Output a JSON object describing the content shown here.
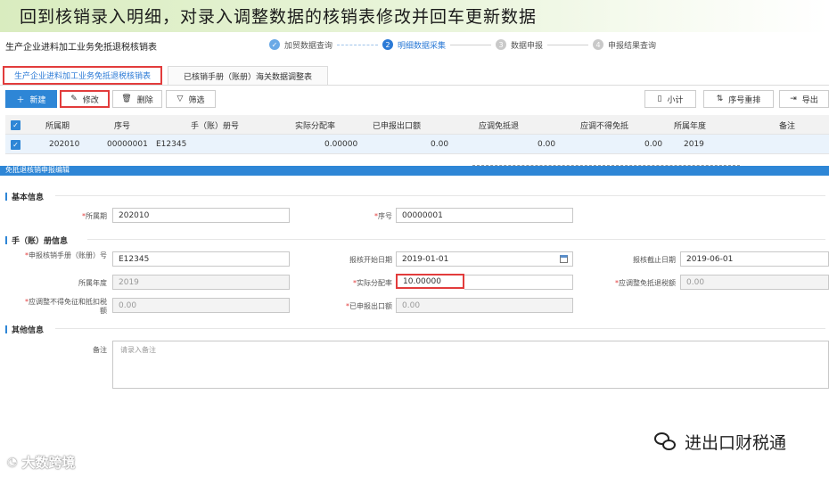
{
  "banner": {
    "title": "回到核销录入明细，对录入调整数据的核销表修改并回车更新数据"
  },
  "page": {
    "title": "生产企业进料加工业务免抵退税核销表"
  },
  "steps": [
    {
      "num": "✓",
      "label": "加贸数据查询"
    },
    {
      "num": "2",
      "label": "明细数据采集"
    },
    {
      "num": "3",
      "label": "数据申报"
    },
    {
      "num": "4",
      "label": "申报结果查询"
    }
  ],
  "tabs": [
    {
      "label": "生产企业进料加工业务免抵退税核销表"
    },
    {
      "label": "已核销手册（账册）海关数据调整表"
    }
  ],
  "toolbar": {
    "new_label": "新建",
    "edit_label": "修改",
    "delete_label": "删除",
    "filter_label": "筛选",
    "subtotal_label": "小计",
    "reorder_label": "序号重排",
    "export_label": "导出"
  },
  "grid": {
    "columns": [
      "所属期",
      "序号",
      "手（账）册号",
      "实际分配率",
      "已申报出口额",
      "应调免抵退",
      "应调不得免抵",
      "所属年度",
      "备注"
    ],
    "rows": [
      [
        "202010",
        "00000001",
        "E12345",
        "0.00000",
        "0.00",
        "0.00",
        "0.00",
        "2019",
        ""
      ]
    ]
  },
  "form": {
    "header": "免抵退核销申报编辑",
    "sections": {
      "basic": "基本信息",
      "manual": "手（账）册信息",
      "other": "其他信息"
    },
    "fields": {
      "period": {
        "label": "所属期",
        "value": "202010"
      },
      "seq": {
        "label": "序号",
        "value": "00000001"
      },
      "manual_no": {
        "label": "申报核销手册（账册）号",
        "value": "E12345"
      },
      "start_date": {
        "label": "报核开始日期",
        "value": "2019-01-01"
      },
      "end_date": {
        "label": "报核截止日期",
        "value": "2019-06-01"
      },
      "year": {
        "label": "所属年度",
        "value": "2019"
      },
      "rate": {
        "label": "实际分配率",
        "value": "10.00000"
      },
      "adj_refund": {
        "label": "应调整免抵退税额",
        "value": "0.00"
      },
      "adj_nondeduct_a": {
        "label": "应调整不得免征和抵扣税",
        "value": "0.00"
      },
      "adj_nondeduct_b": {
        "label": "额"
      },
      "declared_export": {
        "label": "已申报出口额",
        "value": "0.00"
      },
      "remark": {
        "label": "备注",
        "placeholder": "请录入备注"
      }
    }
  },
  "watermarks": {
    "left": "大数跨境",
    "right": "进出口财税通"
  }
}
